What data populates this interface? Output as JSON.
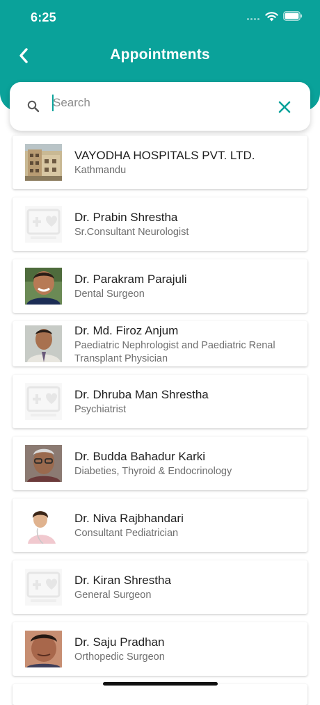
{
  "status_bar": {
    "time": "6:25"
  },
  "header": {
    "title": "Appointments",
    "back_icon": "chevron-left-icon",
    "color": "#0aa29a"
  },
  "search": {
    "placeholder": "Search",
    "value": "",
    "search_icon": "search-icon",
    "clear_icon": "close-icon"
  },
  "doctors": [
    {
      "name": "VAYODHA HOSPITALS PVT. LTD.",
      "specialty": "Kathmandu",
      "photo": "hospital-building"
    },
    {
      "name": "Dr. Prabin Shrestha",
      "specialty": "Sr.Consultant Neurologist",
      "photo": "placeholder-logo"
    },
    {
      "name": "Dr. Parakram Parajuli",
      "specialty": "Dental Surgeon",
      "photo": "doctor-photo"
    },
    {
      "name": "Dr. Md. Firoz Anjum",
      "specialty": "Paediatric Nephrologist and Paediatric Renal Transplant Physician",
      "photo": "doctor-photo"
    },
    {
      "name": "Dr. Dhruba Man Shrestha",
      "specialty": "Psychiatrist",
      "photo": "placeholder-logo"
    },
    {
      "name": "Dr. Budda Bahadur  Karki",
      "specialty": "Diabeties, Thyroid & Endocrinology",
      "photo": "doctor-photo"
    },
    {
      "name": "Dr. Niva Rajbhandari",
      "specialty": "Consultant Pediatrician",
      "photo": "doctor-photo"
    },
    {
      "name": "Dr. Kiran Shrestha",
      "specialty": "General Surgeon",
      "photo": "placeholder-logo"
    },
    {
      "name": "Dr. Saju Pradhan",
      "specialty": "Orthopedic Surgeon",
      "photo": "doctor-photo"
    }
  ]
}
